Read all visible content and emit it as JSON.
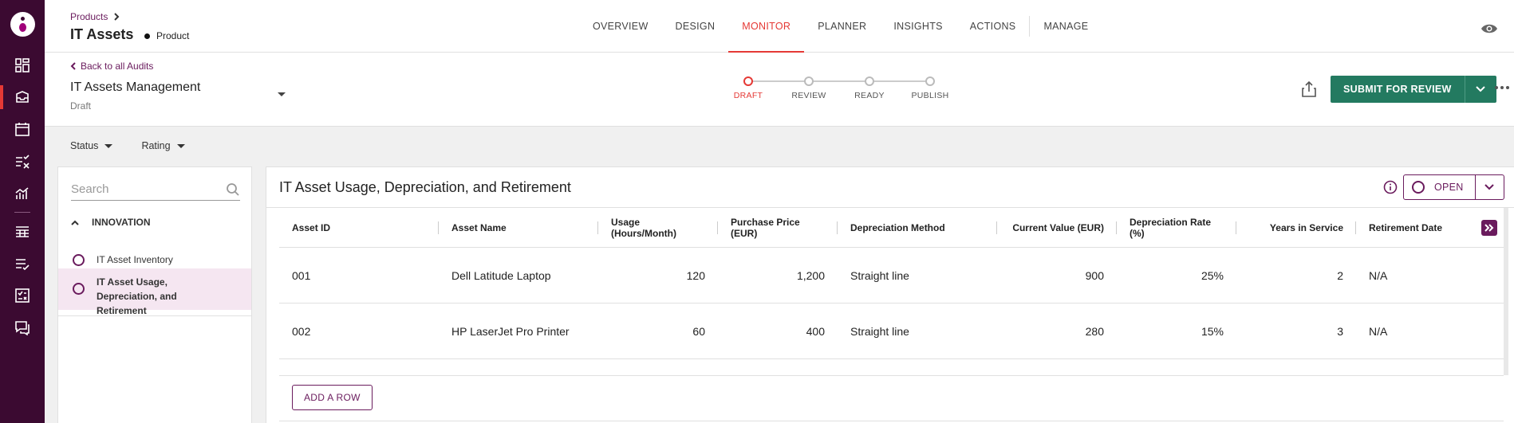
{
  "header": {
    "breadcrumb": "Products",
    "title": "IT Assets",
    "type_label": "Product",
    "tabs": [
      {
        "label": "OVERVIEW"
      },
      {
        "label": "DESIGN"
      },
      {
        "label": "MONITOR"
      },
      {
        "label": "PLANNER"
      },
      {
        "label": "INSIGHTS"
      },
      {
        "label": "ACTIONS"
      },
      {
        "label": "MANAGE"
      }
    ],
    "active_tab": "MONITOR"
  },
  "subheader": {
    "back_label": "Back to all Audits",
    "audit_name": "IT Assets Management",
    "audit_status": "Draft",
    "steps": [
      {
        "label": "DRAFT"
      },
      {
        "label": "REVIEW"
      },
      {
        "label": "READY"
      },
      {
        "label": "PUBLISH"
      }
    ],
    "submit_label": "SUBMIT FOR REVIEW"
  },
  "filters": {
    "status_label": "Status",
    "rating_label": "Rating"
  },
  "sidebar": {
    "search_placeholder": "Search",
    "group_label": "INNOVATION",
    "items": [
      {
        "label": "IT Asset Inventory"
      },
      {
        "label": "IT Asset Usage, Depreciation, and Retirement"
      }
    ]
  },
  "main": {
    "title": "IT Asset Usage, Depreciation, and Retirement",
    "open_label": "OPEN",
    "add_row_label": "ADD A ROW",
    "columns": [
      "Asset ID",
      "Asset Name",
      "Usage (Hours/Month)",
      "Purchase Price (EUR)",
      "Depreciation Method",
      "Current Value (EUR)",
      "Depreciation Rate (%)",
      "Years in Service",
      "Retirement Date"
    ],
    "rows": [
      [
        "001",
        "Dell Latitude Laptop",
        "120",
        "1,200",
        "Straight line",
        "900",
        "25%",
        "2",
        "N/A"
      ],
      [
        "002",
        "HP LaserJet Pro Printer",
        "60",
        "400",
        "Straight line",
        "280",
        "15%",
        "3",
        "N/A"
      ]
    ]
  },
  "colors": {
    "rail": "#3b0a31",
    "accent": "#e53935",
    "primary": "#6a1b5d",
    "submit": "#237a60"
  }
}
